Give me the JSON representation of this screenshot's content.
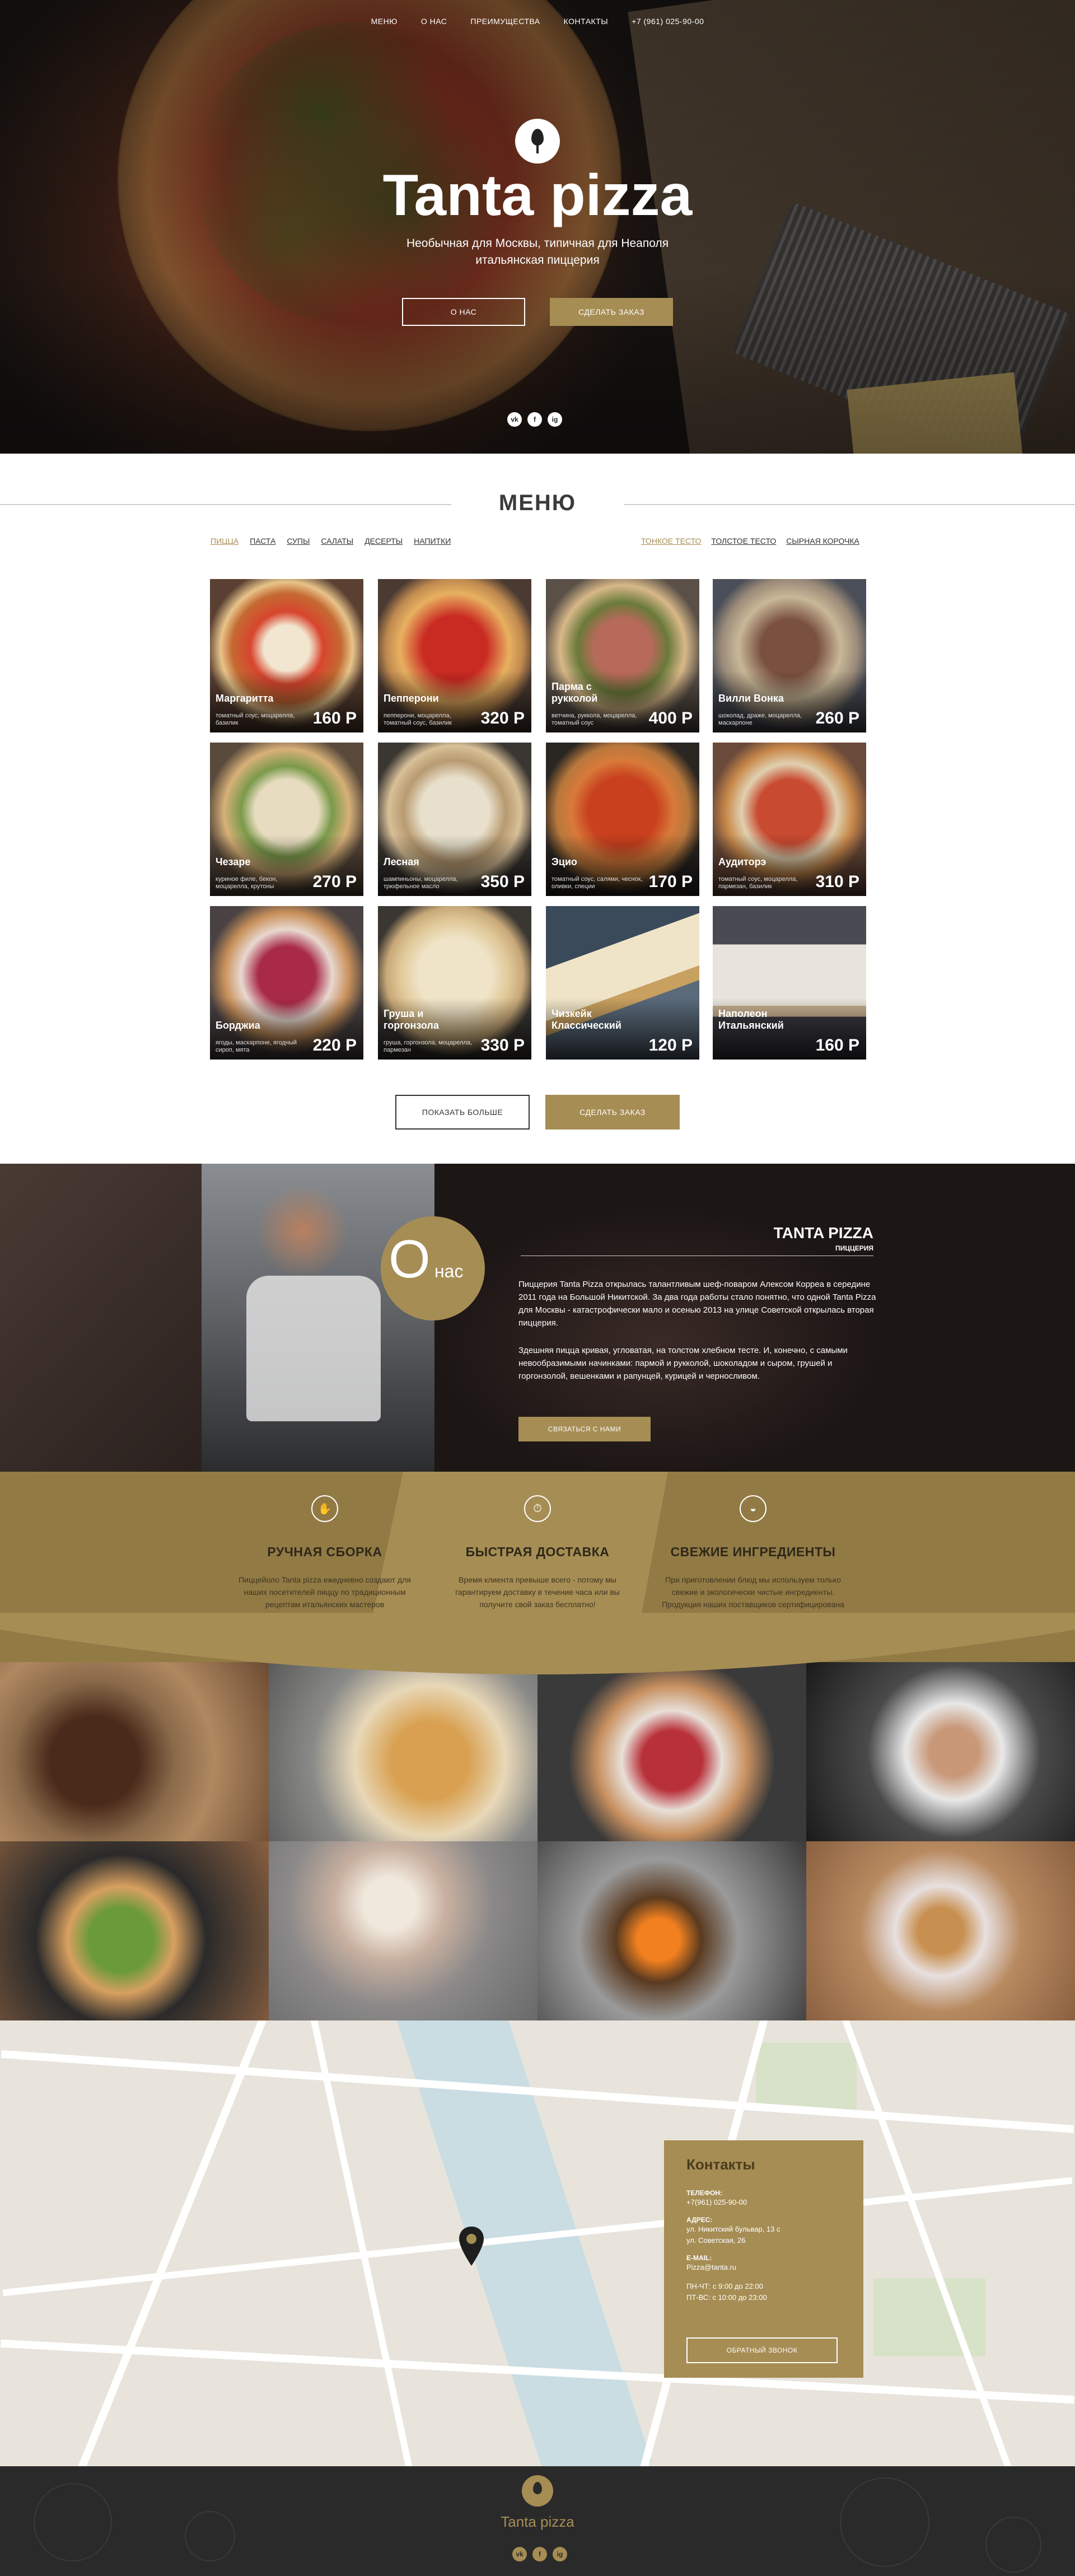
{
  "nav": {
    "items": [
      "МЕНЮ",
      "О НАС",
      "ПРЕИМУЩЕСТВА",
      "КОНТАКТЫ",
      "+7 (961) 025-90-00"
    ]
  },
  "hero": {
    "title": "Tanta pizza",
    "subtitle_line1": "Необычная для Москвы, типичная для Неаполя",
    "subtitle_line2": "итальянская пиццерия",
    "about_btn": "О НАС",
    "order_btn": "СДЕЛАТЬ ЗАКАЗ",
    "socials": [
      "vk",
      "f",
      "ig"
    ]
  },
  "menu": {
    "title": "МЕНЮ",
    "tabs": [
      "ПИЦЦА",
      "ПАСТА",
      "СУПЫ",
      "САЛАТЫ",
      "ДЕСЕРТЫ",
      "НАПИТКИ"
    ],
    "dough": [
      "ТОНКОЕ ТЕСТО",
      "ТОЛСТОЕ ТЕСТО",
      "СЫРНАЯ КОРОЧКА"
    ],
    "items": [
      {
        "name": "Маргаритта",
        "desc": "томатный соус, моцарелла, базилик",
        "price": "160 Р"
      },
      {
        "name": "Пепперони",
        "desc": "пепперони, моцарелла, томатный соус, базилик",
        "price": "320 Р"
      },
      {
        "name": "Парма с рукколой",
        "desc": "ветчина, руккола, моцарелла, томатный соус",
        "price": "400 Р"
      },
      {
        "name": "Вилли Вонка",
        "desc": "шоколад, драже, моцарелла, маскарпоне",
        "price": "260 Р"
      },
      {
        "name": "Чезаре",
        "desc": "куриное филе, бекон, моцарелла, крутоны",
        "price": "270 Р"
      },
      {
        "name": "Лесная",
        "desc": "шампиньоны, моцарелла, трюфельное масло",
        "price": "350 Р"
      },
      {
        "name": "Эцио",
        "desc": "томатный соус, салями, чеснок, оливки, специи",
        "price": "170 Р"
      },
      {
        "name": "Аудиторэ",
        "desc": "томатный соус, моцарелла, пармезан, базилик",
        "price": "310 Р"
      },
      {
        "name": "Борджиа",
        "desc": "ягоды, маскарпоне, ягодный сироп, мята",
        "price": "220 Р"
      },
      {
        "name": "Груша и горгонзола",
        "desc": "груша, горгонзола, моцарелла, пармезан",
        "price": "330 Р"
      },
      {
        "name": "Чизкейк Классический",
        "desc": "",
        "price": "120 Р"
      },
      {
        "name": "Наполеон Итальянский",
        "desc": "",
        "price": "160 Р"
      }
    ],
    "show_more": "ПОКАЗАТЬ БОЛЬШЕ",
    "order_btn": "СДЕЛАТЬ ЗАКАЗ"
  },
  "about": {
    "circle_o": "О",
    "circle_rest": "нас",
    "brand": "TANTA PIZZA",
    "brand_sub": "ПИЦЦЕРИЯ",
    "p1": "Пиццерия Tanta Pizza открылась талантливым шеф-поваром Алексом Корреа в середине 2011 года на Большой Никитской. За два года работы стало понятно, что одной Tanta Pizza для Москвы - катастрофически мало и осенью 2013 на улице Советской открылась вторая пиццерия.",
    "p2": "Здешняя пицца кривая, угловатая, на толстом хлебном тесте. И, конечно, с самыми невообразимыми начинками: пармой и рукколой, шоколадом и сыром, грушей и горгонзолой, вешенками и рапунцей, курицей и черносливом.",
    "contact_btn": "СВЯЗАТЬСЯ С НАМИ"
  },
  "features": [
    {
      "icon": "hand-icon",
      "title": "РУЧНАЯ СБОРКА",
      "desc": "Пиццейоло Tanta pizza ежедневно создают для наших посетителей пиццу по традиционным рецептам итальянских мастеров"
    },
    {
      "icon": "stopwatch-icon",
      "title": "БЫСТРАЯ ДОСТАВКА",
      "desc": "Время клиента превыше всего - потому мы гарантируем доставку в течение часа или вы получите свой заказ бесплатно!"
    },
    {
      "icon": "bowl-icon",
      "title": "СВЕЖИЕ ИНГРЕДИЕНТЫ",
      "desc": "При приготовлении блюд мы используем только свежие и экологически чистые ингредиенты. Продукция наших поставщиков сертифицирована и прошла жесткий контроль."
    }
  ],
  "contacts": {
    "title": "Контакты",
    "phone_label": "ТЕЛЕФОН:",
    "phone": "+7(961) 025-90-00",
    "address_label": "АДРЕС:",
    "address1": "ул. Никитский бульвар, 13 с",
    "address2": "ул. Советская, 26",
    "email_label": "E-MAIL:",
    "email": "Pizza@tanta.ru",
    "hours1": "ПН-ЧТ: с 9:00 до 22:00",
    "hours2": "ПТ-ВС: с 10:00 до 23:00",
    "callback_btn": "ОБРАТНЫЙ ЗВОНОК"
  },
  "footer": {
    "name": "Tanta pizza",
    "socials": [
      "vk",
      "f",
      "ig"
    ]
  },
  "colors": {
    "accent": "#a68d54",
    "dark": "#2a2a2a",
    "white": "#ffffff"
  }
}
